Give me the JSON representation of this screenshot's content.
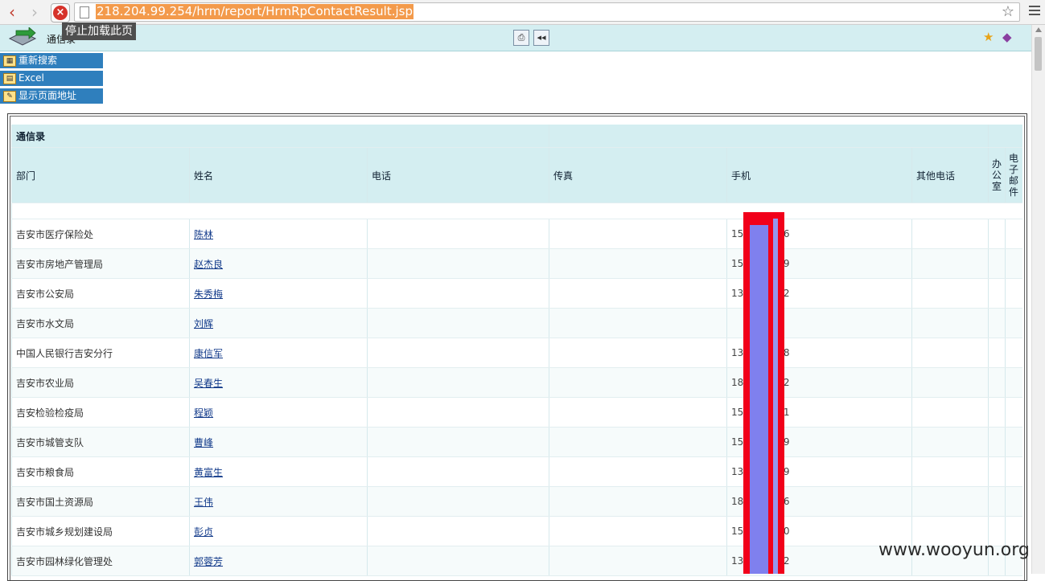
{
  "browser": {
    "url": "218.204.99.254/hrm/report/HrmRpContactResult.jsp",
    "tooltip": "停止加载此页"
  },
  "toolbar": {
    "title": "通信录"
  },
  "actions": [
    {
      "label": "重新搜索",
      "icon": "search-again-icon"
    },
    {
      "label": "Excel",
      "icon": "excel-icon"
    },
    {
      "label": "显示页面地址",
      "icon": "show-address-icon"
    }
  ],
  "table": {
    "title": "通信录",
    "columns": [
      "部门",
      "姓名",
      "电话",
      "传真",
      "手机",
      "其他电话",
      "办公室",
      "电子邮件"
    ],
    "rows": [
      {
        "dept": "吉安市医疗保险处",
        "name": "陈林",
        "mobile": "15 796 0 96"
      },
      {
        "dept": "吉安市房地产管理局",
        "name": "赵杰良",
        "mobile": "15 704 7 79"
      },
      {
        "dept": "吉安市公安局",
        "name": "朱秀梅",
        "mobile": "13 796 9 02"
      },
      {
        "dept": "吉安市水文局",
        "name": "刘辉",
        "mobile": ""
      },
      {
        "dept": "中国人民银行吉安分行",
        "name": "康信军",
        "mobile": "13 070 5 98"
      },
      {
        "dept": "吉安市农业局",
        "name": "吴春生",
        "mobile": "18 079 1 32"
      },
      {
        "dept": "吉安检验检疫局",
        "name": "程颖",
        "mobile": "15 796 9 61"
      },
      {
        "dept": "吉安市城管支队",
        "name": "曹峰",
        "mobile": "15 796 0 19"
      },
      {
        "dept": "吉安市粮食局",
        "name": "黄富生",
        "mobile": "13 796 9 59"
      },
      {
        "dept": "吉安市国土资源局",
        "name": "王伟",
        "mobile": "18 070 2 66"
      },
      {
        "dept": "吉安市城乡规划建设局",
        "name": "彭贞",
        "mobile": "15 796 0 90"
      },
      {
        "dept": "吉安市园林绿化管理处",
        "name": "郭蓉芳",
        "mobile": "13 796 9 72"
      }
    ]
  },
  "watermark": "www.wooyun.org",
  "colors": {
    "header_bg": "#d4eef1",
    "action_bg": "#2f7fbd",
    "mask_red": "#f1001a",
    "mask_blue": "#7f80ee",
    "url_highlight": "#f39a4b"
  }
}
